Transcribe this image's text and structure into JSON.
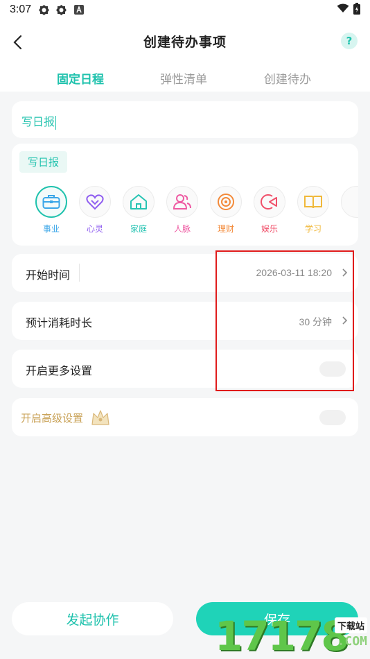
{
  "status_bar": {
    "time": "3:07",
    "icons": [
      "settings-gear-icon",
      "settings-gear-icon",
      "app-a-icon"
    ],
    "right_icons": [
      "wifi-icon",
      "battery-icon"
    ]
  },
  "header": {
    "title": "创建待办事项",
    "help_label": "?"
  },
  "tabs": [
    {
      "label": "固定日程",
      "active": true
    },
    {
      "label": "弹性清单",
      "active": false
    },
    {
      "label": "创建待办",
      "active": false
    }
  ],
  "task_input": {
    "value": "写日报"
  },
  "categories_card": {
    "selected_chip": "写日报",
    "items": [
      {
        "label": "事业",
        "icon": "briefcase-icon",
        "color": "#3aa6e8",
        "selected": true
      },
      {
        "label": "心灵",
        "icon": "heart-icon",
        "color": "#8e5cf0",
        "selected": false
      },
      {
        "label": "家庭",
        "icon": "house-icon",
        "color": "#27c4b3",
        "selected": false
      },
      {
        "label": "人脉",
        "icon": "people-icon",
        "color": "#ee5aa2",
        "selected": false
      },
      {
        "label": "理财",
        "icon": "coin-icon",
        "color": "#f38a3a",
        "selected": false
      },
      {
        "label": "娱乐",
        "icon": "game-icon",
        "color": "#f0506a",
        "selected": false
      },
      {
        "label": "学习",
        "icon": "book-icon",
        "color": "#f0b83a",
        "selected": false
      }
    ]
  },
  "start_time": {
    "label": "开始时间",
    "value": "2026-03-11 18:20"
  },
  "duration": {
    "label": "预计消耗时长",
    "value": "30 分钟"
  },
  "more_settings": {
    "label": "开启更多设置",
    "enabled": false
  },
  "advanced_settings": {
    "label": "开启高级设置",
    "enabled": false
  },
  "buttons": {
    "collaborate": "发起协作",
    "save": "保存"
  },
  "watermark": {
    "numbers": "17178",
    "tag": "下载站",
    "domain": ".COM"
  },
  "colors": {
    "accent": "#1fc2ad",
    "save_button": "#1fd3b8",
    "gold": "#c9a257",
    "highlight": "#e01b1b"
  }
}
